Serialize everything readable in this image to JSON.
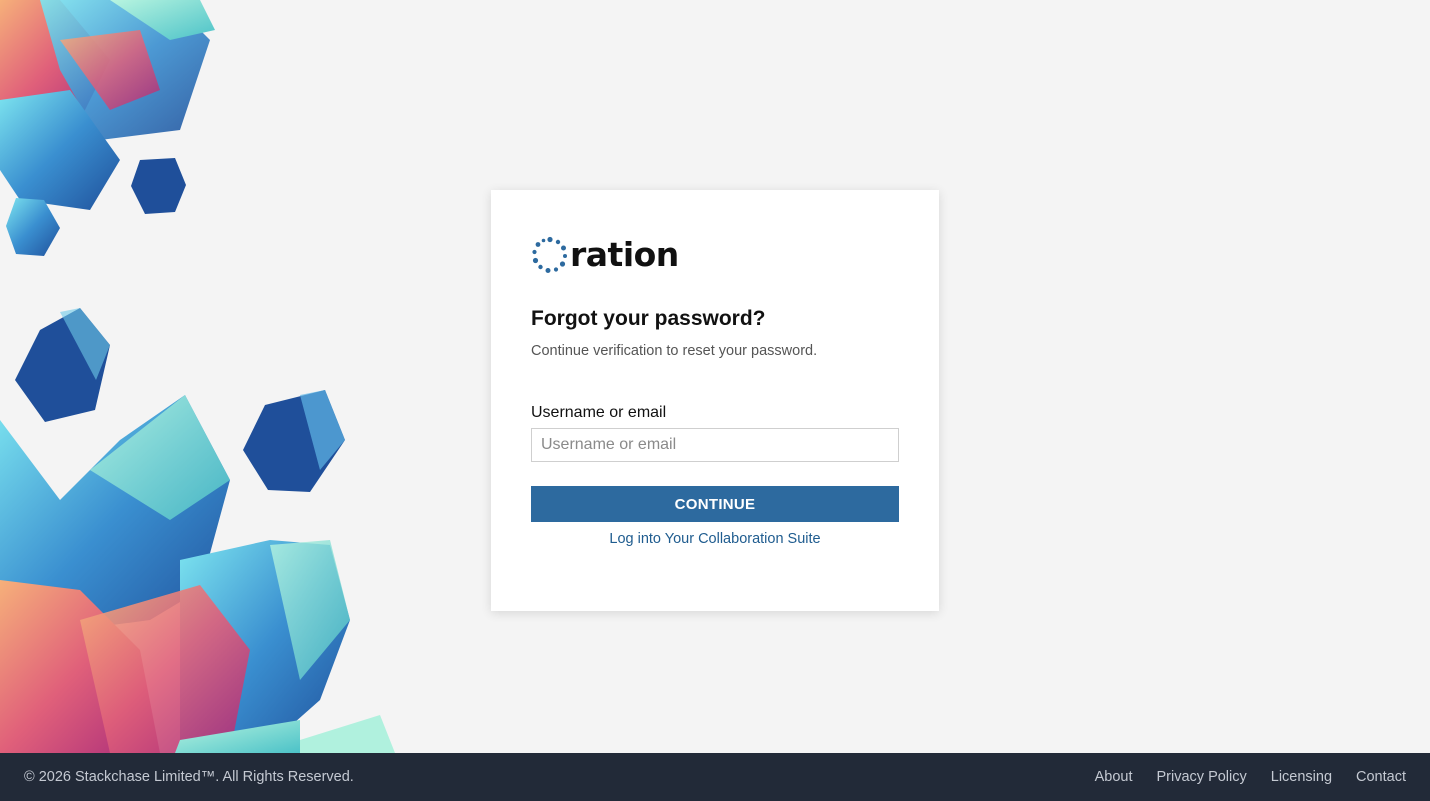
{
  "brand": {
    "logo_text": "ration",
    "logo_icon": "dotted-ring-icon",
    "accent_color": "#2d6a9f"
  },
  "form": {
    "title": "Forgot your password?",
    "subtitle": "Continue verification to reset your password.",
    "username_label": "Username or email",
    "username_placeholder": "Username or email",
    "username_value": "",
    "continue_label": "CONTINUE",
    "suite_link_label": "Log into Your Collaboration Suite"
  },
  "footer": {
    "copyright": "© 2026 Stackchase Limited™. All Rights Reserved.",
    "links": [
      "About",
      "Privacy Policy",
      "Licensing",
      "Contact"
    ]
  }
}
